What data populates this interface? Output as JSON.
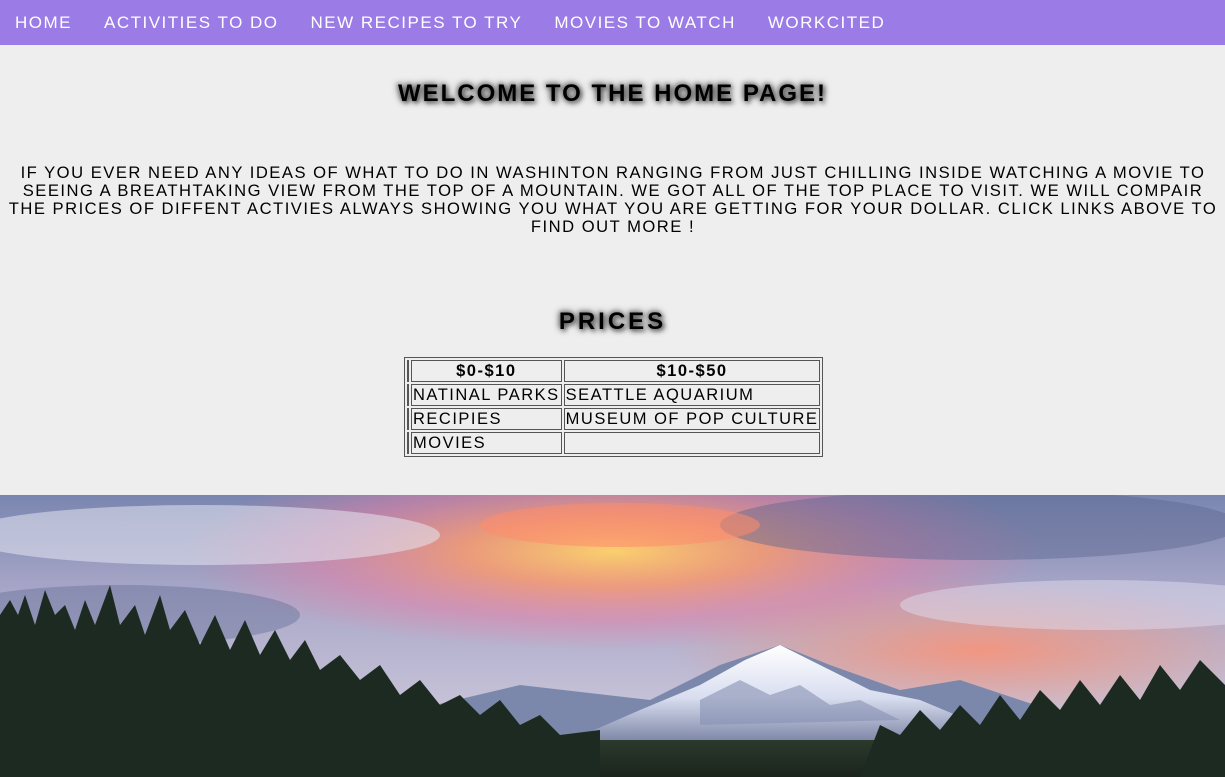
{
  "nav": {
    "items": [
      {
        "label": "HOME"
      },
      {
        "label": "ACTIVITIES TO DO"
      },
      {
        "label": "NEW RECIPES TO TRY"
      },
      {
        "label": "MOVIES TO WATCH"
      },
      {
        "label": "WORKCITED"
      }
    ],
    "background": "#9b7be6"
  },
  "page": {
    "title": "WELCOME TO THE HOME PAGE!",
    "intro": "IF YOU EVER NEED ANY IDEAS OF WHAT TO DO IN WASHINTON RANGING FROM JUST CHILLING INSIDE WATCHING A MOVIE TO SEEING A BREATHTAKING VIEW FROM THE TOP OF A MOUNTAIN. WE GOT ALL OF THE TOP PLACE TO VISIT. WE WILL COMPAIR THE PRICES OF DIFFENT ACTIVIES ALWAYS SHOWING YOU WHAT YOU ARE GETTING FOR YOUR DOLLAR. CLICK LINKS ABOVE TO FIND OUT MORE !"
  },
  "prices": {
    "title": "PRICES",
    "headers": [
      "$0-$10",
      "$10-$50"
    ],
    "rows": [
      [
        "NATINAL PARKS",
        "SEATTLE AQUARIUM"
      ],
      [
        "RECIPIES",
        "MUSEUM OF POP CULTURE"
      ],
      [
        "MOVIES",
        ""
      ]
    ]
  },
  "hero": {
    "image": "mountain-sunset-landscape"
  }
}
